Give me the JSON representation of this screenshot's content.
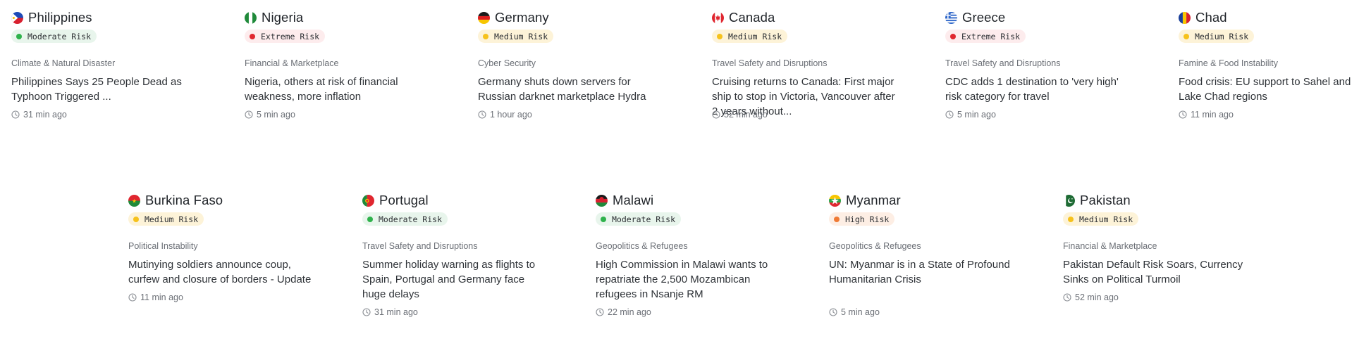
{
  "risk_styles": {
    "Moderate Risk": {
      "bg": "#e8f5ec",
      "dot": "#2fb24c"
    },
    "Extreme Risk": {
      "bg": "#fdeced",
      "dot": "#e0272f"
    },
    "Medium Risk": {
      "bg": "#fdf3d8",
      "dot": "#f6c21c"
    },
    "High Risk": {
      "bg": "#fdeee4",
      "dot": "#ef7a35"
    }
  },
  "cards": [
    {
      "country": "Philippines",
      "flag": "philippines-flag-icon",
      "risk": "Moderate Risk",
      "category": "Climate & Natural Disaster",
      "headline": "Philippines Says 25 People Dead as Typhoon Triggered ...",
      "time": "31 min ago"
    },
    {
      "country": "Nigeria",
      "flag": "nigeria-flag-icon",
      "risk": "Extreme Risk",
      "category": "Financial & Marketplace",
      "headline": "Nigeria, others at risk of financial weakness, more inflation",
      "time": "5 min ago"
    },
    {
      "country": "Germany",
      "flag": "germany-flag-icon",
      "risk": "Medium Risk",
      "category": "Cyber Security",
      "headline": "Germany shuts down servers for Russian darknet marketplace Hydra",
      "time": "1 hour ago"
    },
    {
      "country": "Canada",
      "flag": "canada-flag-icon",
      "risk": "Medium Risk",
      "category": "Travel Safety and Disruptions",
      "headline": "Cruising returns to Canada: First major ship to stop in Victoria, Vancouver after 2 years without...",
      "time": "52 min ago"
    },
    {
      "country": "Greece",
      "flag": "greece-flag-icon",
      "risk": "Extreme Risk",
      "category": "Travel Safety and Disruptions",
      "headline": "CDC adds 1 destination to 'very high' risk category for travel",
      "time": "5 min ago"
    },
    {
      "country": "Chad",
      "flag": "chad-flag-icon",
      "risk": "Medium Risk",
      "category": "Famine & Food Instability",
      "headline": "Food crisis: EU support to Sahel and Lake Chad regions",
      "time": "11 min ago"
    },
    {
      "country": "Burkina Faso",
      "flag": "burkina-faso-flag-icon",
      "risk": "Medium Risk",
      "category": "Political Instability",
      "headline": "Mutinying soldiers announce coup, curfew and closure of borders - Update",
      "time": "11 min ago"
    },
    {
      "country": "Portugal",
      "flag": "portugal-flag-icon",
      "risk": "Moderate Risk",
      "category": "Travel Safety and Disruptions",
      "headline": "Summer holiday warning as flights to Spain, Portugal and Germany face huge delays",
      "time": "31 min ago"
    },
    {
      "country": "Malawi",
      "flag": "malawi-flag-icon",
      "risk": "Moderate Risk",
      "category": "Geopolitics & Refugees",
      "headline": "High Commission in Malawi wants to repatriate the 2,500 Mozambican refugees in Nsanje RM",
      "time": "22 min ago"
    },
    {
      "country": "Myanmar",
      "flag": "myanmar-flag-icon",
      "risk": "High Risk",
      "category": "Geopolitics & Refugees",
      "headline": "UN: Myanmar is in a State of Profound Humanitarian Crisis",
      "time": "5 min ago"
    },
    {
      "country": "Pakistan",
      "flag": "pakistan-flag-icon",
      "risk": "Medium Risk",
      "category": "Financial & Marketplace",
      "headline": "Pakistan Default Risk Soars, Currency Sinks on Political Turmoil",
      "time": "52 min ago"
    }
  ]
}
